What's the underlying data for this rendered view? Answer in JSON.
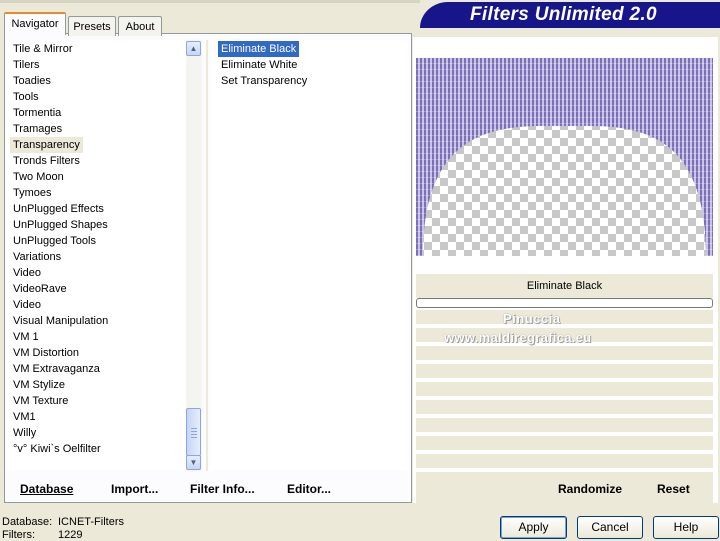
{
  "window": {
    "title": "Filters Unlimited 2.0"
  },
  "tabs": [
    {
      "label": "Navigator",
      "active": true
    },
    {
      "label": "Presets",
      "active": false
    },
    {
      "label": "About",
      "active": false
    }
  ],
  "categories": {
    "items": [
      "Tile & Mirror",
      "Tilers",
      "Toadies",
      "Tools",
      "Tormentia",
      "Tramages",
      "Transparency",
      "Tronds Filters",
      "Two Moon",
      "Tymoes",
      "UnPlugged Effects",
      "UnPlugged Shapes",
      "UnPlugged Tools",
      "Variations",
      "Video",
      "VideoRave",
      "Video",
      "Visual Manipulation",
      "VM 1",
      "VM Distortion",
      "VM Extravaganza",
      "VM Stylize",
      "VM Texture",
      "VM1",
      "Willy",
      "°v° Kiwi`s Oelfilter"
    ],
    "selected": "Transparency"
  },
  "filters": {
    "items": [
      "Eliminate Black",
      "Eliminate White",
      "Set Transparency"
    ],
    "selected": "Eliminate Black"
  },
  "left_actions": {
    "database": "Database",
    "import": "Import...",
    "filter_info": "Filter Info...",
    "editor": "Editor..."
  },
  "preview": {
    "caption": "Eliminate Black",
    "progress": 0,
    "colors": {
      "purple": "#7b6fbc",
      "stripe": "#c9c4e6"
    }
  },
  "watermark": {
    "line1": "Pinuccia",
    "line2": "www.maldiregrafica.eu"
  },
  "right_actions": {
    "randomize": "Randomize",
    "reset": "Reset"
  },
  "status": {
    "database_label": "Database:",
    "database_value": "ICNET-Filters",
    "filters_label": "Filters:",
    "filters_value": "1229"
  },
  "buttons": {
    "apply": "Apply",
    "cancel": "Cancel",
    "help": "Help"
  }
}
